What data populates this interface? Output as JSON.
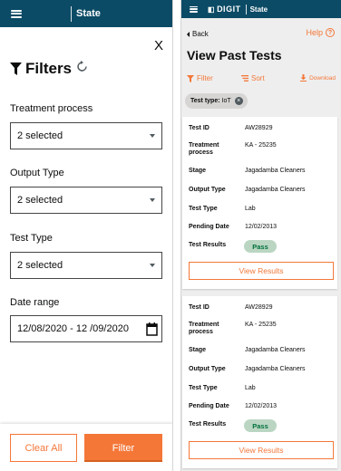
{
  "left": {
    "header": {
      "state_label": "State"
    },
    "close_glyph": "X",
    "title": "Filters",
    "fields": [
      {
        "label": "Treatment process",
        "value": "2 selected"
      },
      {
        "label": "Output Type",
        "value": "2 selected"
      },
      {
        "label": "Test Type",
        "value": "2 selected"
      },
      {
        "label": "Date range",
        "value": "12/08/2020 - 12 /09/2020"
      }
    ],
    "buttons": {
      "clear": "Clear All",
      "filter": "Filter"
    }
  },
  "right": {
    "header": {
      "logo_text": "DIGIT",
      "state_label": "State"
    },
    "back": "Back",
    "help": "Help",
    "help_glyph": "?",
    "title": "View Past Tests",
    "actions": {
      "filter": "Filter",
      "sort": "Sort",
      "download": "Download"
    },
    "chip": {
      "key": "Test type:",
      "value": "IoT"
    },
    "field_labels": {
      "test_id": "Test ID",
      "treatment_process": "Treatment process",
      "stage": "Stage",
      "output_type": "Output Type",
      "test_type": "Test Type",
      "pending_date": "Pending Date",
      "test_results": "Test Results"
    },
    "cards": [
      {
        "test_id": "AW28929",
        "treatment_process": "KA - 25235",
        "stage": "Jagadamba Cleaners",
        "output_type": "Jagadamba Cleaners",
        "test_type": "Lab",
        "pending_date": "12/02/2013",
        "result": "Pass",
        "button": "View Results"
      },
      {
        "test_id": "AW28929",
        "treatment_process": "KA - 25235",
        "stage": "Jagadamba Cleaners",
        "output_type": "Jagadamba Cleaners",
        "test_type": "Lab",
        "pending_date": "12/02/2013",
        "result": "Pass",
        "button": "View Results"
      }
    ]
  },
  "colors": {
    "header_bg": "#0b4b66",
    "accent": "#f47738",
    "pass_bg": "#bad6c2",
    "pass_text": "#00703c",
    "chip_bg": "#d6d5d4",
    "page_bg": "#eeeeee"
  },
  "icons": [
    "hamburger-icon",
    "close-icon",
    "funnel-icon",
    "refresh-icon",
    "chevron-down-icon",
    "calendar-icon",
    "back-arrow-icon",
    "help-icon",
    "filter-icon",
    "sort-icon",
    "download-icon",
    "remove-chip-icon"
  ]
}
